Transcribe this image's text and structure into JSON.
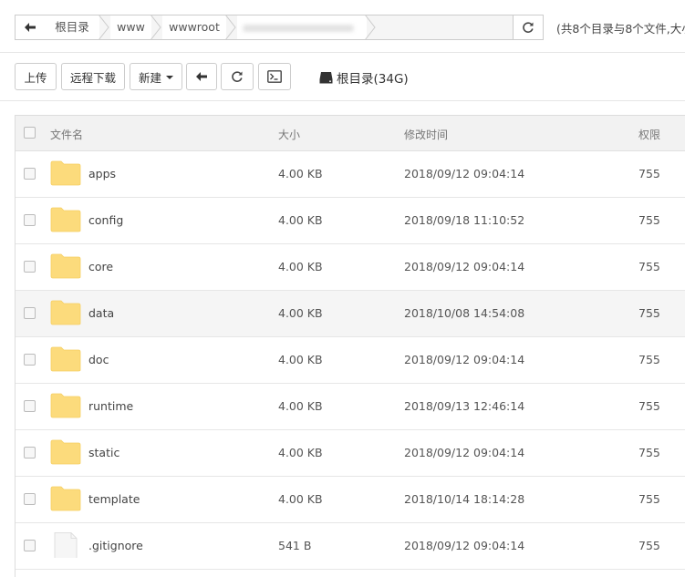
{
  "breadcrumb": {
    "items": [
      "根目录",
      "www",
      "wwwroot",
      "redacted-folder"
    ],
    "summary": "(共8个目录与8个文件,大小"
  },
  "toolbar": {
    "upload": "上传",
    "remote_download": "远程下载",
    "new": "新建",
    "disk_info": "根目录(34G)"
  },
  "table": {
    "headers": {
      "name": "文件名",
      "size": "大小",
      "modified": "修改时间",
      "perm": "权限"
    },
    "rows": [
      {
        "name": "apps",
        "type": "folder",
        "size": "4.00 KB",
        "modified": "2018/09/12 09:04:14",
        "perm": "755"
      },
      {
        "name": "config",
        "type": "folder",
        "size": "4.00 KB",
        "modified": "2018/09/18 11:10:52",
        "perm": "755"
      },
      {
        "name": "core",
        "type": "folder",
        "size": "4.00 KB",
        "modified": "2018/09/12 09:04:14",
        "perm": "755"
      },
      {
        "name": "data",
        "type": "folder",
        "size": "4.00 KB",
        "modified": "2018/10/08 14:54:08",
        "perm": "755",
        "highlighted": true
      },
      {
        "name": "doc",
        "type": "folder",
        "size": "4.00 KB",
        "modified": "2018/09/12 09:04:14",
        "perm": "755"
      },
      {
        "name": "runtime",
        "type": "folder",
        "size": "4.00 KB",
        "modified": "2018/09/13 12:46:14",
        "perm": "755"
      },
      {
        "name": "static",
        "type": "folder",
        "size": "4.00 KB",
        "modified": "2018/09/12 09:04:14",
        "perm": "755"
      },
      {
        "name": "template",
        "type": "folder",
        "size": "4.00 KB",
        "modified": "2018/10/14 18:14:28",
        "perm": "755"
      },
      {
        "name": ".gitignore",
        "type": "file",
        "size": "541 B",
        "modified": "2018/09/12 09:04:14",
        "perm": "755"
      }
    ]
  },
  "colors": {
    "folder": "#fcdb7c",
    "folder_edge": "#f5cf63",
    "file": "#f6f6f6"
  },
  "icons": [
    "back-arrow-icon",
    "refresh-icon",
    "terminal-icon",
    "hard-drive-icon",
    "folder-icon",
    "file-icon"
  ]
}
